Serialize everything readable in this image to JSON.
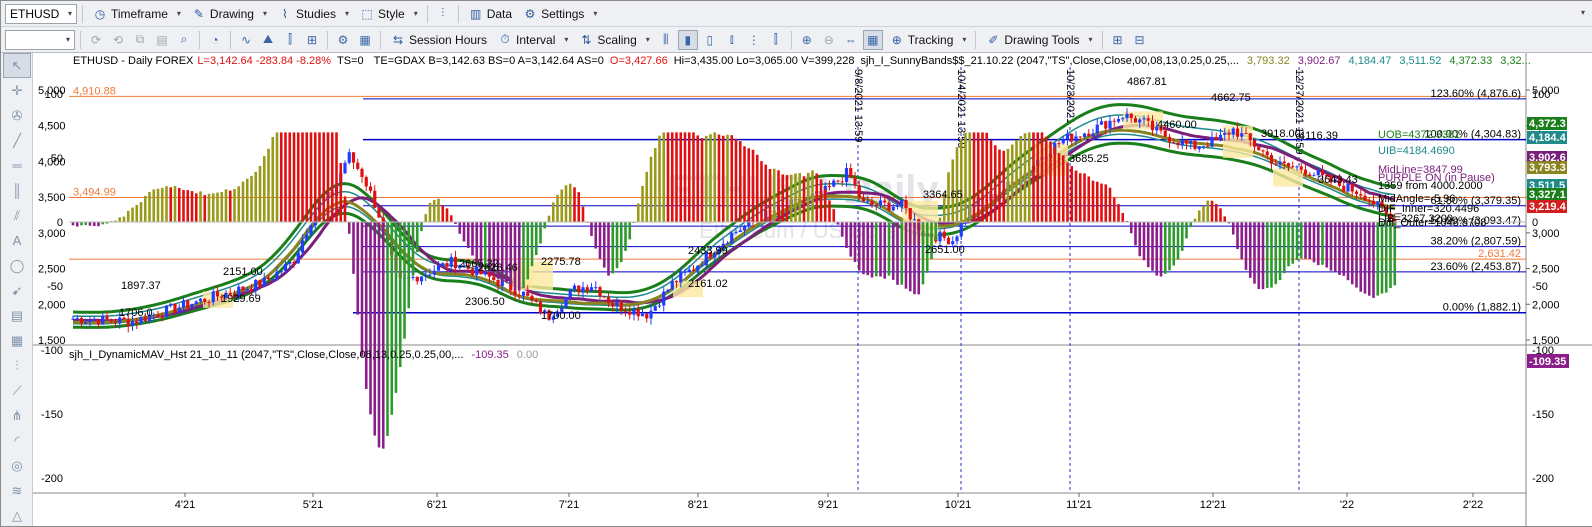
{
  "toolbar1": {
    "symbol": "ETHUSD",
    "timeframe": "Timeframe",
    "drawing": "Drawing",
    "studies": "Studies",
    "style": "Style",
    "data": "Data",
    "settings": "Settings"
  },
  "toolbar2": {
    "session_hours": "Session Hours",
    "interval": "Interval",
    "scaling": "Scaling",
    "tracking": "Tracking",
    "drawing_tools": "Drawing Tools"
  },
  "header": {
    "symbol_line": "ETHUSD - Daily  FOREX",
    "last": "L=3,142.64  -283.84  -8.28%",
    "ts": "TS=0",
    "quote": "TE=GDAX  B=3,142.63  BS=0  A=3,142.64  AS=0",
    "open": "O=3,427.66",
    "hlv": "Hi=3,435.00  Lo=3,065.00  V=399,228",
    "study": "sjh_I_SunnyBands$$_21.10.22 (2047,\"TS\",Close,Close,00,08,13,0.25,0.25,...",
    "v1": "3,793.32",
    "v2": "3,902.67",
    "v3": "4,184.47",
    "v4": "3,511.52",
    "v5": "4,372.33",
    "v6": "3,32..."
  },
  "watermark": {
    "symbol": "ETHUSD Daily",
    "sub": "Ethereum / US Dollar"
  },
  "panel2": {
    "title": "sjh_I_DynamicMAV_Hst 21_10_11 (2047,\"TS\",Close,Close,08,13,0.25,0.25,00,...",
    "value": "-109.35",
    "zero": "0.00"
  },
  "price_axis": [
    "5,000",
    "4,500",
    "4,000",
    "3,500",
    "3,000",
    "2,500",
    "2,000",
    "1,500"
  ],
  "hist_axis": [
    "100",
    "50",
    "0",
    "-50",
    "-100",
    "-150",
    "-200"
  ],
  "x_labels": [
    "4'21",
    "5'21",
    "6'21",
    "7'21",
    "8'21",
    "9'21",
    "10'21",
    "11'21",
    "12'21",
    "'22",
    "2'22"
  ],
  "fib_levels": [
    {
      "label": "123.60% (4,876.6)",
      "price": 4876.6
    },
    {
      "label": "100.00% (4,304.83)",
      "price": 4304.83
    },
    {
      "label": "61.80% (3,379.35)",
      "price": 3379.35
    },
    {
      "label": "50.00% (3,093.47)",
      "price": 3093.47
    },
    {
      "label": "38.20% (2,807.59)",
      "price": 2807.59
    },
    {
      "label": "23.60% (2,453.87)",
      "price": 2453.87
    },
    {
      "label": "0.00% (1,882.1)",
      "price": 1882.1
    }
  ],
  "horizontal_lines": [
    {
      "label": "4,910.88",
      "price": 4910.88
    },
    {
      "label": "3,494.99",
      "price": 3494.99
    },
    {
      "label": "2,631.42",
      "price": 2631.42
    }
  ],
  "chart_labels": [
    "1897.37",
    "1706.0",
    "2151.00",
    "1929.69",
    "2665.32",
    "2628.46",
    "2306.50",
    "2275.78",
    "1700.00",
    "2161.02",
    "2433.99",
    "3364.65",
    "2651.00",
    "3685.25",
    "4867.81",
    "4460.00",
    "4662.75",
    "3918.00",
    "4116.39",
    "3643.43"
  ],
  "vline_dates": [
    "9/8/2021 13:59",
    "10/4/2021 13:59",
    "10/23/2021",
    "12/27/2021 13:59"
  ],
  "right_labels": {
    "uob": "UOB=4372.3361",
    "uib": "UIB=4184.4690",
    "midline": "MidLine=3847.99",
    "purple": "PURPLE ON (in Pause)",
    "t1359": "1359 from 4000.2000",
    "midangle": "MidAngle=-5.96",
    "dif": "DIF_Inner=320.4496",
    "lib": "LIB=3267.3200",
    "diff_outer": "Diff_Outer=1048.8708"
  },
  "right_tags": [
    {
      "text": "4,372.3",
      "color": "#1a7f1a"
    },
    {
      "text": "4,184.4",
      "color": "#1f8a8a"
    },
    {
      "text": "3,902.6",
      "color": "#7a1f7a"
    },
    {
      "text": "3,793.3",
      "color": "#8a8420"
    },
    {
      "text": "3,511.5",
      "color": "#1f8a8a"
    },
    {
      "text": "3,327.1",
      "color": "#1a7f1a"
    },
    {
      "text": "3,219.4",
      "color": "#d11f1f"
    }
  ],
  "hist_tag": "-109.35",
  "colors": {
    "up": "#1f3cff",
    "down": "#e01010",
    "band_outer": "#1a7f1a",
    "band_inner": "#1f8a8a",
    "mid_purple": "#7a1f7a",
    "mid_olive": "#8a8420",
    "fib": "#0000cc",
    "orange": "#f07a3a",
    "hist_green": "#2e9a2e",
    "hist_red": "#e01010",
    "hist_olive": "#9a9a1a",
    "hist_purple": "#8b1e8b"
  }
}
